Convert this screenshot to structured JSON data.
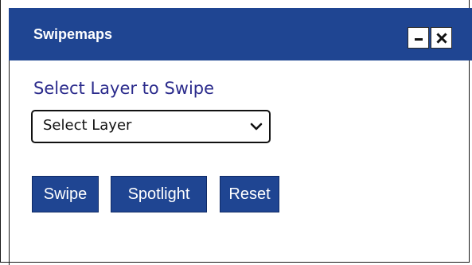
{
  "window": {
    "title": "Swipemaps",
    "minimize_icon": "minimize-icon",
    "close_icon": "close-icon"
  },
  "layer_select": {
    "prompt": "Select Layer to Swipe",
    "selected": "Select Layer",
    "chevron_icon": "chevron-down-icon"
  },
  "actions": {
    "swipe": "Swipe",
    "spotlight": "Spotlight",
    "reset": "Reset"
  },
  "colors": {
    "accent": "#1f4592",
    "prompt_text": "#2b2b8c"
  }
}
